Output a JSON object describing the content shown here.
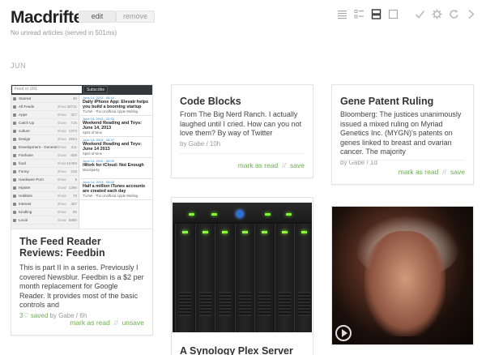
{
  "app": {
    "title": "Macdrifter",
    "edit_label": "edit",
    "remove_label": "remove",
    "status": "No unread articles (served in 501ms)"
  },
  "toolbar": {
    "icons": [
      "list-view-icon",
      "summary-view-icon",
      "card-view-icon",
      "full-view-icon",
      "mark-all-read-icon",
      "settings-icon",
      "refresh-icon",
      "next-icon"
    ]
  },
  "section": {
    "label": "JUN"
  },
  "cards": {
    "feedbin": {
      "title": "The Feed Reader Reviews: Feedbin",
      "text": "This is part II in a series. Previously I covered Newsblur. Feedbin is a $2 per month replacement for Google Reader. It provides most of the basic controls and",
      "saved_prefix": "3",
      "saved_label": "saved",
      "meta": "by Gabe / 6h",
      "mark_label": "mark as read",
      "sep": "//",
      "save_label": "unsave",
      "screenshot": {
        "search_placeholder": "Feed or URL",
        "subscribe_label": "Subscribe",
        "sidebar": [
          {
            "name": "Starred",
            "show": "",
            "count": "38"
          },
          {
            "name": "All Feeds",
            "show": "show",
            "count": "36711"
          },
          {
            "name": "Apps",
            "show": "show",
            "count": "327"
          },
          {
            "name": "Catch Up",
            "show": "show",
            "count": "716"
          },
          {
            "name": "culture",
            "show": "show",
            "count": "1374"
          },
          {
            "name": "Design",
            "show": "show",
            "count": "4924"
          },
          {
            "name": "Development - General",
            "show": "show",
            "count": "411"
          },
          {
            "name": "Firehose",
            "show": "show",
            "count": "808"
          },
          {
            "name": "food",
            "show": "show",
            "count": "10459"
          },
          {
            "name": "Funny",
            "show": "show",
            "count": "316"
          },
          {
            "name": "Hardware Porn",
            "show": "show",
            "count": "8"
          },
          {
            "name": "Hipster",
            "show": "show",
            "count": "1266"
          },
          {
            "name": "Hobbies",
            "show": "show",
            "count": "78"
          },
          {
            "name": "Interest",
            "show": "show",
            "count": "467"
          },
          {
            "name": "Kindling",
            "show": "show",
            "count": "55"
          },
          {
            "name": "Local",
            "show": "show",
            "count": "6886"
          }
        ],
        "entries": [
          {
            "date": "June 14, 2013 - 08:44",
            "title": "Daily iPhone App: Elevatr helps you build a booming startup",
            "source": "TUAW - The Unofficial Apple Weblog"
          },
          {
            "date": "June 14, 2013 - 10:00",
            "title": "Weekend Reading and Toys: June 14, 2013",
            "source": "Spirit of Nine"
          },
          {
            "date": "June 14, 2013 - 08:37",
            "title": "Weekend Reading and Toys: June 14 2013",
            "source": "Spirit of Nine"
          },
          {
            "date": "June 14, 2013 - 08:00",
            "title": "iWork for iCloud: Not Enough",
            "source": "MacSparky"
          },
          {
            "date": "June 14, 2013 - 08:00",
            "title": "Half a million iTunes accounts are created each day",
            "source": "TUAW - The Unofficial Apple Weblog"
          }
        ]
      }
    },
    "codeblocks": {
      "title": "Code Blocks",
      "text": "From The Big Nerd Ranch. I actually laughed until I cried. How can you not love them? By way of Twitter",
      "meta": "by Gabe / 10h",
      "mark_label": "mark as read",
      "sep": "//",
      "save_label": "save"
    },
    "gene": {
      "title": "Gene Patent Ruling",
      "text": "Bloomberg: The justices unanimously issued a mixed ruling on Myriad Genetics Inc. (MYGN)'s patents on genes linked to breast and ovarian cancer. The majority",
      "meta": "by Gabe / 1d",
      "mark_label": "mark as read",
      "sep": "//",
      "save_label": "save"
    },
    "synology": {
      "title": "A Synology Plex Server"
    },
    "video": {}
  },
  "colors": {
    "accent": "#6ab04c",
    "text": "#333333",
    "muted": "#999999"
  }
}
